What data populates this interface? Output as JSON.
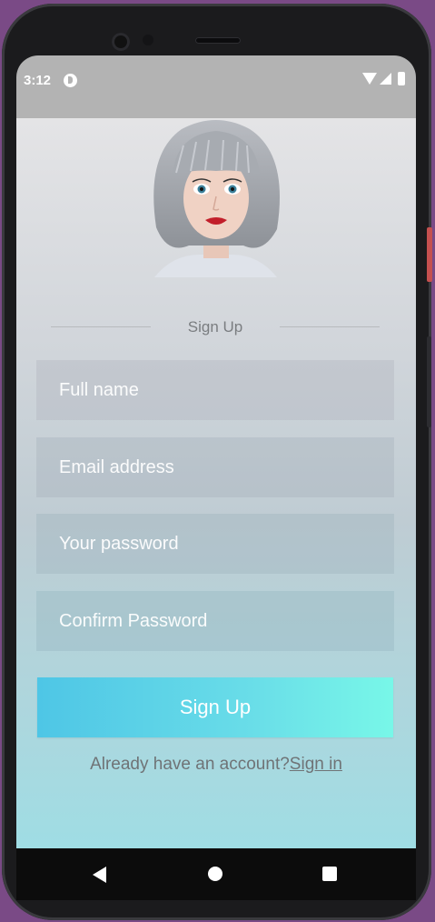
{
  "status_bar": {
    "time": "3:12",
    "icons": [
      "app-notification-icon",
      "wifi-icon",
      "signal-icon",
      "battery-icon"
    ]
  },
  "header": {
    "avatar_icon": "robot-avatar-illustration",
    "divider_label": "Sign Up"
  },
  "form": {
    "full_name": {
      "placeholder": "Full name",
      "value": ""
    },
    "email": {
      "placeholder": "Email address",
      "value": ""
    },
    "password": {
      "placeholder": "Your password",
      "value": ""
    },
    "confirm_password": {
      "placeholder": "Confirm Password",
      "value": ""
    },
    "submit_label": "Sign Up"
  },
  "footer": {
    "prompt": "Already have an account?",
    "link": "Sign in"
  },
  "navigation_bar": {
    "icons": [
      "back-icon",
      "home-icon",
      "recents-icon"
    ]
  },
  "colors": {
    "button_gradient_start": "#4ec6e6",
    "button_gradient_end": "#78f7e8",
    "background_top": "#e4e4e6",
    "background_bottom": "#9fdde4"
  }
}
